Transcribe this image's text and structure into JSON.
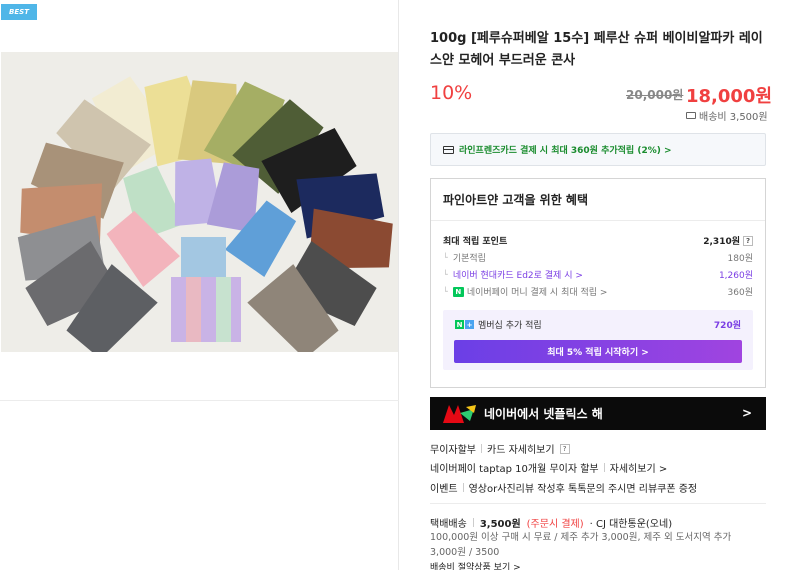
{
  "left": {
    "badge": "BEST",
    "photo_alt": "yarn-cones"
  },
  "product": {
    "title": "100g [페루슈퍼베알 15수] 페루산 슈퍼 베이비알파카 레이스얀 모헤어 부드러운 콘사",
    "discount": "10%",
    "original_price": "20,000원",
    "price": "18,000원",
    "shipping_fee": "배송비 3,500원"
  },
  "card_banner": "라인프렌즈카드 결제 시 최대 360원 추가적립 (2%) >",
  "benefit": {
    "title": "파인아트얀 고객을 위한 혜택",
    "max_points_label": "최대 적립 포인트",
    "max_points_value": "2,310원",
    "basic_label": "기본적립",
    "basic_value": "180원",
    "hyundai_label": "네이버 현대카드 Ed2로 결제 시 >",
    "hyundai_value": "1,260원",
    "naverpay_label": "네이버페이 머니 결제 시 최대 적립 >",
    "naverpay_value": "360원",
    "membership_label": "멤버십 추가 적립",
    "membership_value": "720원",
    "membership_button": "최대 5% 적립 시작하기 >"
  },
  "netflix": {
    "text": "네이버에서 넷플릭스 해",
    "arrow": ">"
  },
  "info": {
    "installment": "무이자할부",
    "card_detail": "카드 자세히보기",
    "taptap": "네이버페이 taptap 10개월 무이자 할부",
    "taptap_detail": "자세히보기 >",
    "event_label": "이벤트",
    "event_text": "영상or사진리뷰 작성후 톡톡문의 주시면 리뷰쿠폰 증정"
  },
  "shipping": {
    "label": "택배배송",
    "fee": "3,500원",
    "fee_note": "(주문시 결제)",
    "carrier": "· CJ 대한통운(오네)",
    "detail": "100,000원 이상 구매 시 무료 / 제주 추가 3,000원, 제주 외 도서지역 추가 3,000원 / 3500",
    "more": "배송비 절약상품 보기 >"
  },
  "colors": {
    "accent_red": "#f04040",
    "green": "#1a8c2e",
    "purple": "#7b3fe4",
    "badge_blue": "#4fb6e8"
  }
}
